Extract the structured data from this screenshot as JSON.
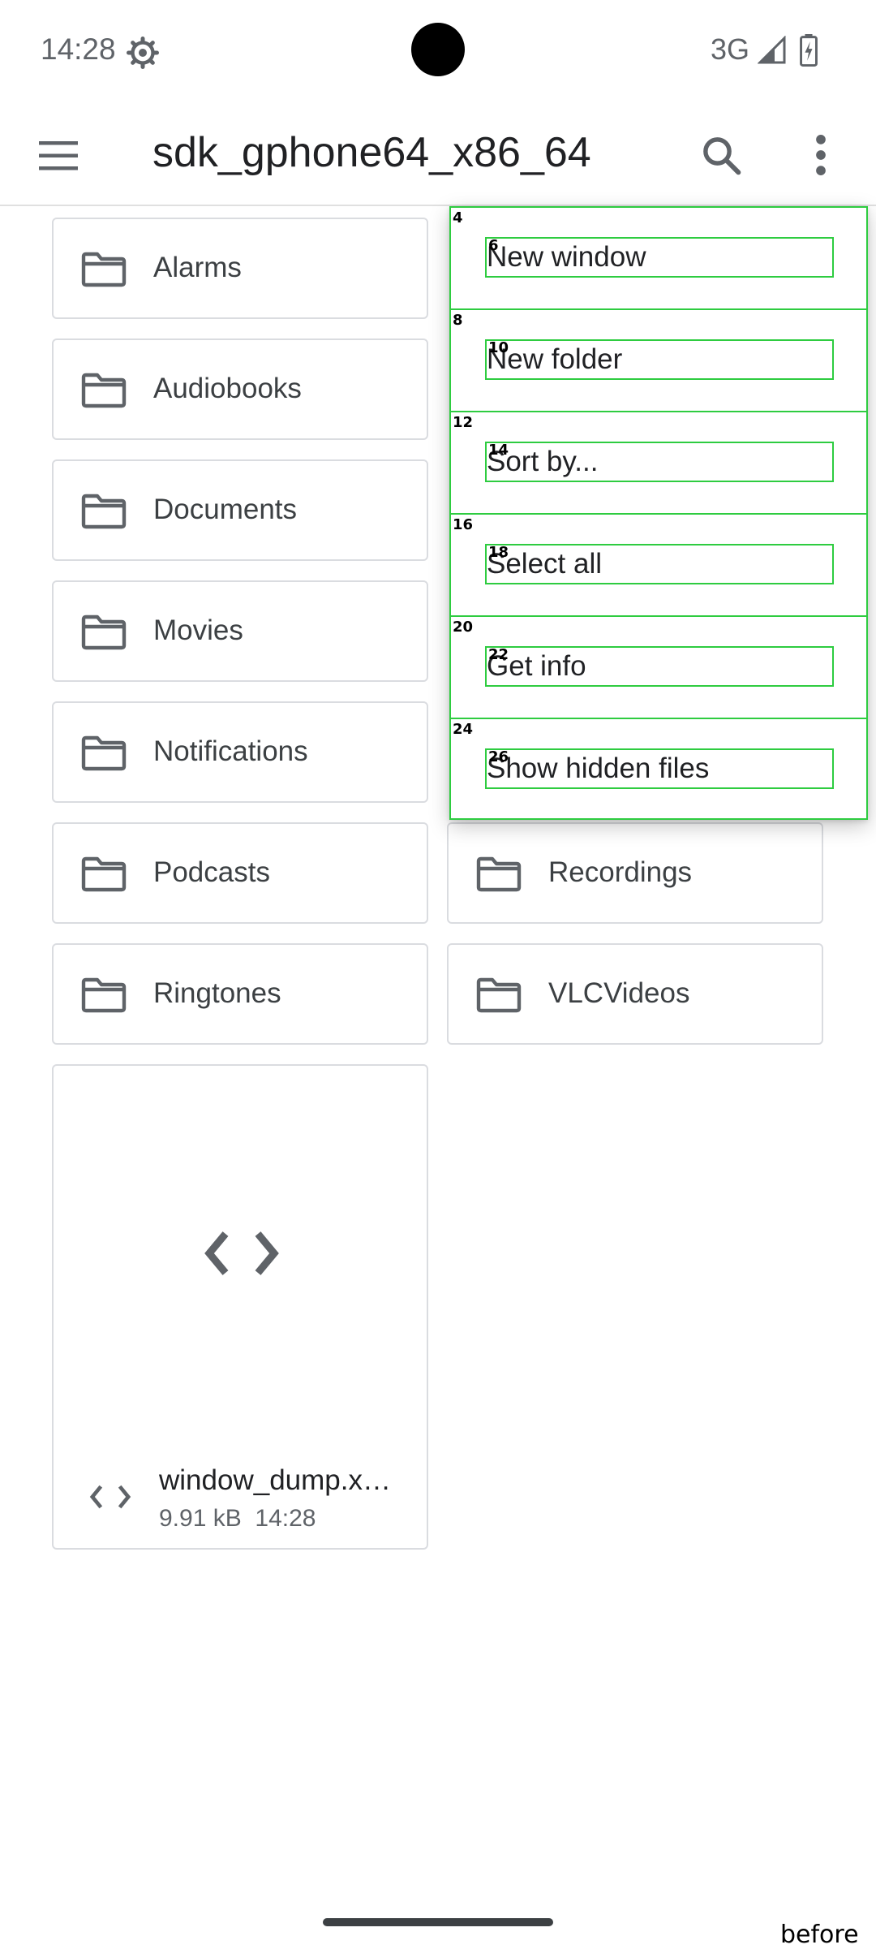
{
  "status_bar": {
    "time": "14:28",
    "network": "3G"
  },
  "toolbar": {
    "title": "sdk_gphone64_x86_64"
  },
  "folders": [
    {
      "label": "Alarms"
    },
    {
      "label": "Audiobooks"
    },
    {
      "label": "Documents"
    },
    {
      "label": "Movies"
    },
    {
      "label": "Notifications"
    },
    {
      "label": "Podcasts"
    },
    {
      "label": "Recordings"
    },
    {
      "label": "Ringtones"
    },
    {
      "label": "VLCVideos"
    }
  ],
  "file": {
    "name": "window_dump.x…",
    "size": "9.91 kB",
    "time": "14:28"
  },
  "menu": {
    "items": [
      {
        "label": "New window",
        "item_marker": "4",
        "label_marker": "6"
      },
      {
        "label": "New folder",
        "item_marker": "8",
        "label_marker": "10"
      },
      {
        "label": "Sort by...",
        "item_marker": "12",
        "label_marker": "14"
      },
      {
        "label": "Select all",
        "item_marker": "16",
        "label_marker": "18"
      },
      {
        "label": "Get info",
        "item_marker": "20",
        "label_marker": "22"
      },
      {
        "label": "Show hidden files",
        "item_marker": "24",
        "label_marker": "26"
      }
    ]
  },
  "footer": {
    "caption": "before"
  },
  "colors": {
    "annotation": "#2ecc40",
    "border": "#dadce0",
    "icon": "#5f6368"
  }
}
